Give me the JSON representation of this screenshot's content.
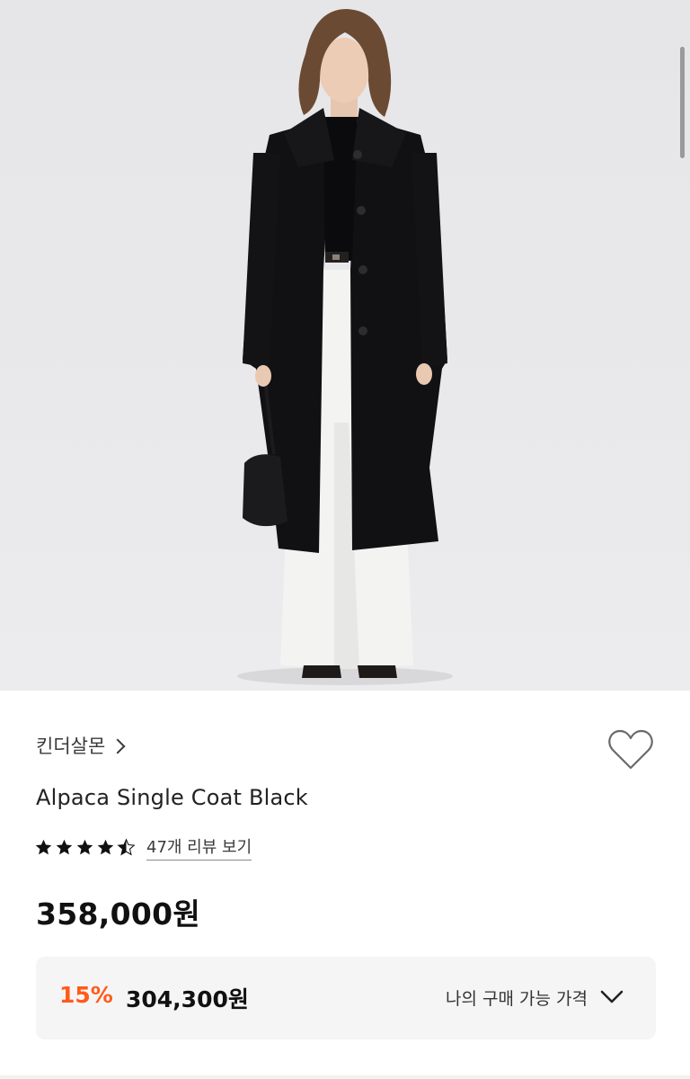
{
  "product": {
    "brand": "킨더살몬",
    "title": "Alpaca Single Coat Black",
    "rating": 4.5,
    "review_link": "47개 리뷰 보기",
    "price": "358,000원",
    "discount": {
      "rate": "15%",
      "price": "304,300원",
      "label": "나의 구매 가능 가격"
    }
  },
  "photo": {
    "alt": "product-photo",
    "background": "#e8e8ea"
  },
  "colors": {
    "accent_discount": "#ff5b1a",
    "text_primary": "#111111",
    "panel_bg": "#f5f5f5"
  },
  "icons": {
    "wishlist": "heart-outline-icon",
    "brand_chevron": "chevron-right-icon",
    "dropdown": "chevron-down-icon",
    "rating": "star-icon"
  }
}
